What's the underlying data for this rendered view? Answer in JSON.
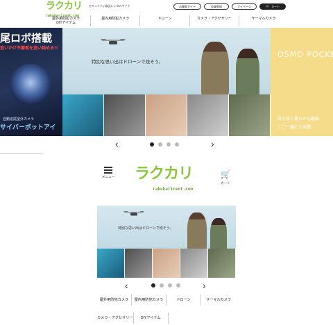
{
  "desktop": {
    "logo": {
      "text": "ラクカリ",
      "sub": "rakukarirent.com"
    },
    "tagline": "セキュリティ製品レンタルサイト",
    "util": {
      "guide": "お買物ガイド",
      "register": "会員登録",
      "mypage": "マイページ",
      "cart": "カート"
    },
    "nav": [
      {
        "line1": "屋外用防犯カメラ",
        "line2": "DIYアイテム"
      },
      {
        "line1": "屋内用防犯カメラ",
        "line2": ""
      },
      {
        "line1": "ドローン",
        "line2": ""
      },
      {
        "line1": "カメラ・アクセサリー",
        "line2": ""
      },
      {
        "line1": "サーマルカメラ",
        "line2": ""
      }
    ],
    "carousel": {
      "left": {
        "headline": "尾ロボ搭載",
        "sub": "追いかけ不審者を追い詰める!!",
        "bottom1": "自動追尾屋外カメラ",
        "bottom2": "サイバーボットアイ"
      },
      "main": {
        "caption": "特別な思い出はドローンで残そう。"
      },
      "right": {
        "brand": "OSMO POCKET",
        "line1": "持ち歩く滑らかな動画",
        "line2": "ここ一番に大活躍"
      },
      "prev": "‹",
      "next": "›"
    }
  },
  "mobile": {
    "menu_label": "メニュー",
    "cart_label": "カート",
    "logo": {
      "text": "ラクカリ",
      "sub": "rakukarirent.com"
    },
    "carousel": {
      "caption": "特別な思い出はドローンで残そう。",
      "prev": "‹",
      "next": "›"
    },
    "nav": [
      [
        "屋外用防犯カメラ",
        "屋内用防犯カメラ",
        "ドローン",
        "サーマルカメラ"
      ],
      [
        "カメラ・アクセサリー",
        "DIYアイテム"
      ]
    ]
  },
  "colors": {
    "brand_green": "#8cc63f",
    "cart_bg": "#222222",
    "osmo_yellow": "#f5dc8a"
  },
  "icons": [
    "menu-icon",
    "cart-icon",
    "drone-icon",
    "chevron-left-icon",
    "chevron-right-icon"
  ]
}
